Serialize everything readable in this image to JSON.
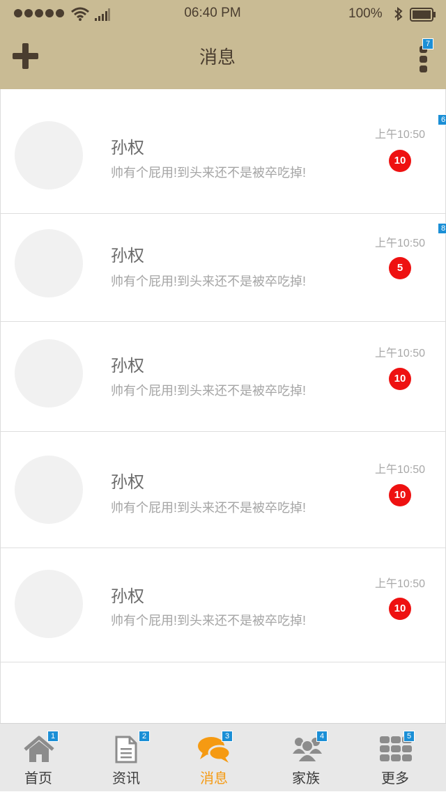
{
  "status_bar": {
    "time": "06:40 PM",
    "battery": "100%"
  },
  "header": {
    "title": "消息",
    "more_badge": "7"
  },
  "messages": [
    {
      "name": "孙权",
      "preview": "帅有个屁用!到头来还不是被卒吃掉!",
      "time": "上午10:50",
      "unread": "10",
      "tag": "6"
    },
    {
      "name": "孙权",
      "preview": "帅有个屁用!到头来还不是被卒吃掉!",
      "time": "上午10:50",
      "unread": "5",
      "tag": "8"
    },
    {
      "name": "孙权",
      "preview": "帅有个屁用!到头来还不是被卒吃掉!",
      "time": "上午10:50",
      "unread": "10"
    },
    {
      "name": "孙权",
      "preview": "帅有个屁用!到头来还不是被卒吃掉!",
      "time": "上午10:50",
      "unread": "10"
    },
    {
      "name": "孙权",
      "preview": "帅有个屁用!到头来还不是被卒吃掉!",
      "time": "上午10:50",
      "unread": "10"
    }
  ],
  "tabs": [
    {
      "label": "首页",
      "icon": "home-icon",
      "tag": "1"
    },
    {
      "label": "资讯",
      "icon": "document-icon",
      "tag": "2"
    },
    {
      "label": "消息",
      "icon": "chat-icon",
      "tag": "3",
      "active": true
    },
    {
      "label": "家族",
      "icon": "group-icon",
      "tag": "4"
    },
    {
      "label": "更多",
      "icon": "grid-icon",
      "tag": "5"
    }
  ],
  "colors": {
    "header_bg": "#c9bb94",
    "accent": "#f59a12",
    "badge": "#ee1111",
    "tag": "#1b8fd6"
  }
}
